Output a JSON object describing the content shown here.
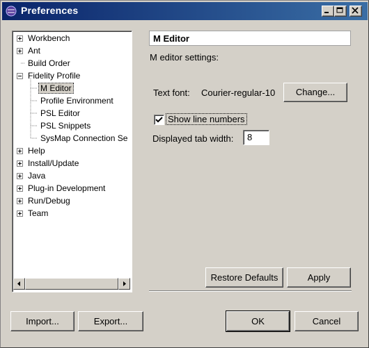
{
  "window": {
    "title": "Preferences"
  },
  "tree": {
    "items": [
      {
        "label": "Workbench",
        "expander": "plus"
      },
      {
        "label": "Ant",
        "expander": "plus"
      },
      {
        "label": "Build Order",
        "expander": "none"
      },
      {
        "label": "Fidelity Profile",
        "expander": "minus"
      },
      {
        "label": "M Editor",
        "expander": "none",
        "selected": true
      },
      {
        "label": "Profile Environment",
        "expander": "none"
      },
      {
        "label": "PSL Editor",
        "expander": "none"
      },
      {
        "label": "PSL Snippets",
        "expander": "none"
      },
      {
        "label": "SysMap Connection Se",
        "expander": "none"
      },
      {
        "label": "Help",
        "expander": "plus"
      },
      {
        "label": "Install/Update",
        "expander": "plus"
      },
      {
        "label": "Java",
        "expander": "plus"
      },
      {
        "label": "Plug-in Development",
        "expander": "plus"
      },
      {
        "label": "Run/Debug",
        "expander": "plus"
      },
      {
        "label": "Team",
        "expander": "plus"
      }
    ]
  },
  "page": {
    "title": "M Editor",
    "description": "M editor settings:",
    "text_font_label": "Text font:",
    "text_font_value": "Courier-regular-10",
    "change_button": "Change...",
    "show_line_numbers_label": "Show line numbers",
    "show_line_numbers_checked": true,
    "tab_width_label": "Displayed tab width:",
    "tab_width_value": "8",
    "restore_defaults_button": "Restore Defaults",
    "apply_button": "Apply"
  },
  "footer": {
    "import_button": "Import...",
    "export_button": "Export...",
    "ok_button": "OK",
    "cancel_button": "Cancel"
  }
}
